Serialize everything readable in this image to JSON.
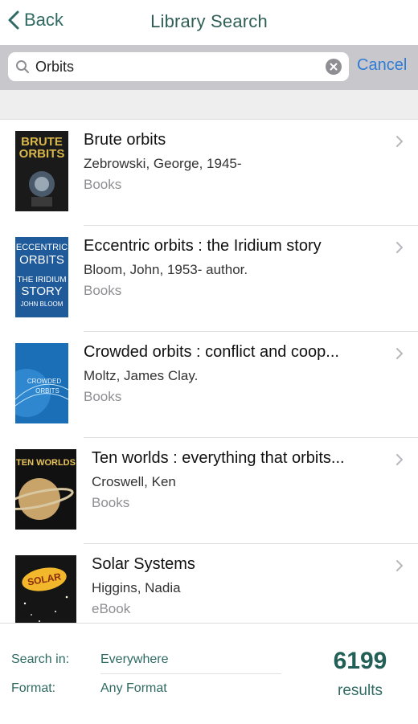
{
  "nav": {
    "back_label": "Back",
    "title": "Library Search"
  },
  "search": {
    "value": "Orbits",
    "cancel_label": "Cancel"
  },
  "results": [
    {
      "title": "Brute orbits",
      "author": "Zebrowski, George, 1945-",
      "format": "Books",
      "cover": {
        "lines": [
          "BRUTE",
          "ORBITS"
        ],
        "bg": "#1a1a1a",
        "fg": "#d8b64a"
      }
    },
    {
      "title": "Eccentric orbits : the Iridium story",
      "author": "Bloom, John, 1953- author.",
      "format": "Books",
      "cover": {
        "lines": [
          "ECCENTRIC",
          "ORBITS",
          "THE IRIDIUM",
          "STORY",
          "JOHN BLOOM"
        ],
        "bg": "#1f5a9a",
        "fg": "#ffffff"
      }
    },
    {
      "title": "Crowded orbits : conflict and coop...",
      "author": "Moltz, James Clay.",
      "format": "Books",
      "cover": {
        "lines": [
          "CROWDED",
          "ORBITS"
        ],
        "bg": "#1a6fb6",
        "fg": "#e9f4ff"
      }
    },
    {
      "title": "Ten worlds : everything that orbits...",
      "author": "Croswell, Ken",
      "format": "Books",
      "cover": {
        "lines": [
          "TEN WORLDS"
        ],
        "bg": "#111111",
        "fg": "#e8c35a"
      }
    },
    {
      "title": "Solar Systems",
      "author": "Higgins, Nadia",
      "format": "eBook",
      "cover": {
        "lines": [
          "SOLAR"
        ],
        "bg": "#151515",
        "fg": "#f2b72a"
      }
    }
  ],
  "footer": {
    "search_in_label": "Search in:",
    "search_in_value": "Everywhere",
    "format_label": "Format:",
    "format_value": "Any Format",
    "count": "6199",
    "count_label": "results"
  },
  "colors": {
    "accent": "#2f6b63",
    "link": "#2f7bd6"
  }
}
